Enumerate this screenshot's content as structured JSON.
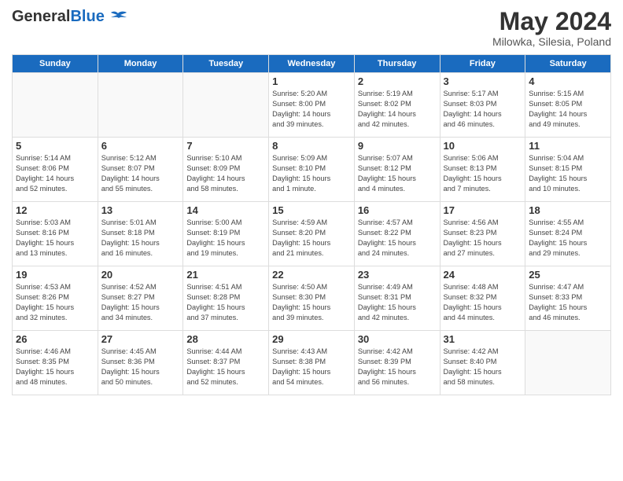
{
  "header": {
    "logo_general": "General",
    "logo_blue": "Blue",
    "title": "May 2024",
    "subtitle": "Milowka, Silesia, Poland"
  },
  "days_of_week": [
    "Sunday",
    "Monday",
    "Tuesday",
    "Wednesday",
    "Thursday",
    "Friday",
    "Saturday"
  ],
  "weeks": [
    [
      {
        "day": "",
        "info": ""
      },
      {
        "day": "",
        "info": ""
      },
      {
        "day": "",
        "info": ""
      },
      {
        "day": "1",
        "info": "Sunrise: 5:20 AM\nSunset: 8:00 PM\nDaylight: 14 hours\nand 39 minutes."
      },
      {
        "day": "2",
        "info": "Sunrise: 5:19 AM\nSunset: 8:02 PM\nDaylight: 14 hours\nand 42 minutes."
      },
      {
        "day": "3",
        "info": "Sunrise: 5:17 AM\nSunset: 8:03 PM\nDaylight: 14 hours\nand 46 minutes."
      },
      {
        "day": "4",
        "info": "Sunrise: 5:15 AM\nSunset: 8:05 PM\nDaylight: 14 hours\nand 49 minutes."
      }
    ],
    [
      {
        "day": "5",
        "info": "Sunrise: 5:14 AM\nSunset: 8:06 PM\nDaylight: 14 hours\nand 52 minutes."
      },
      {
        "day": "6",
        "info": "Sunrise: 5:12 AM\nSunset: 8:07 PM\nDaylight: 14 hours\nand 55 minutes."
      },
      {
        "day": "7",
        "info": "Sunrise: 5:10 AM\nSunset: 8:09 PM\nDaylight: 14 hours\nand 58 minutes."
      },
      {
        "day": "8",
        "info": "Sunrise: 5:09 AM\nSunset: 8:10 PM\nDaylight: 15 hours\nand 1 minute."
      },
      {
        "day": "9",
        "info": "Sunrise: 5:07 AM\nSunset: 8:12 PM\nDaylight: 15 hours\nand 4 minutes."
      },
      {
        "day": "10",
        "info": "Sunrise: 5:06 AM\nSunset: 8:13 PM\nDaylight: 15 hours\nand 7 minutes."
      },
      {
        "day": "11",
        "info": "Sunrise: 5:04 AM\nSunset: 8:15 PM\nDaylight: 15 hours\nand 10 minutes."
      }
    ],
    [
      {
        "day": "12",
        "info": "Sunrise: 5:03 AM\nSunset: 8:16 PM\nDaylight: 15 hours\nand 13 minutes."
      },
      {
        "day": "13",
        "info": "Sunrise: 5:01 AM\nSunset: 8:18 PM\nDaylight: 15 hours\nand 16 minutes."
      },
      {
        "day": "14",
        "info": "Sunrise: 5:00 AM\nSunset: 8:19 PM\nDaylight: 15 hours\nand 19 minutes."
      },
      {
        "day": "15",
        "info": "Sunrise: 4:59 AM\nSunset: 8:20 PM\nDaylight: 15 hours\nand 21 minutes."
      },
      {
        "day": "16",
        "info": "Sunrise: 4:57 AM\nSunset: 8:22 PM\nDaylight: 15 hours\nand 24 minutes."
      },
      {
        "day": "17",
        "info": "Sunrise: 4:56 AM\nSunset: 8:23 PM\nDaylight: 15 hours\nand 27 minutes."
      },
      {
        "day": "18",
        "info": "Sunrise: 4:55 AM\nSunset: 8:24 PM\nDaylight: 15 hours\nand 29 minutes."
      }
    ],
    [
      {
        "day": "19",
        "info": "Sunrise: 4:53 AM\nSunset: 8:26 PM\nDaylight: 15 hours\nand 32 minutes."
      },
      {
        "day": "20",
        "info": "Sunrise: 4:52 AM\nSunset: 8:27 PM\nDaylight: 15 hours\nand 34 minutes."
      },
      {
        "day": "21",
        "info": "Sunrise: 4:51 AM\nSunset: 8:28 PM\nDaylight: 15 hours\nand 37 minutes."
      },
      {
        "day": "22",
        "info": "Sunrise: 4:50 AM\nSunset: 8:30 PM\nDaylight: 15 hours\nand 39 minutes."
      },
      {
        "day": "23",
        "info": "Sunrise: 4:49 AM\nSunset: 8:31 PM\nDaylight: 15 hours\nand 42 minutes."
      },
      {
        "day": "24",
        "info": "Sunrise: 4:48 AM\nSunset: 8:32 PM\nDaylight: 15 hours\nand 44 minutes."
      },
      {
        "day": "25",
        "info": "Sunrise: 4:47 AM\nSunset: 8:33 PM\nDaylight: 15 hours\nand 46 minutes."
      }
    ],
    [
      {
        "day": "26",
        "info": "Sunrise: 4:46 AM\nSunset: 8:35 PM\nDaylight: 15 hours\nand 48 minutes."
      },
      {
        "day": "27",
        "info": "Sunrise: 4:45 AM\nSunset: 8:36 PM\nDaylight: 15 hours\nand 50 minutes."
      },
      {
        "day": "28",
        "info": "Sunrise: 4:44 AM\nSunset: 8:37 PM\nDaylight: 15 hours\nand 52 minutes."
      },
      {
        "day": "29",
        "info": "Sunrise: 4:43 AM\nSunset: 8:38 PM\nDaylight: 15 hours\nand 54 minutes."
      },
      {
        "day": "30",
        "info": "Sunrise: 4:42 AM\nSunset: 8:39 PM\nDaylight: 15 hours\nand 56 minutes."
      },
      {
        "day": "31",
        "info": "Sunrise: 4:42 AM\nSunset: 8:40 PM\nDaylight: 15 hours\nand 58 minutes."
      },
      {
        "day": "",
        "info": ""
      }
    ]
  ]
}
